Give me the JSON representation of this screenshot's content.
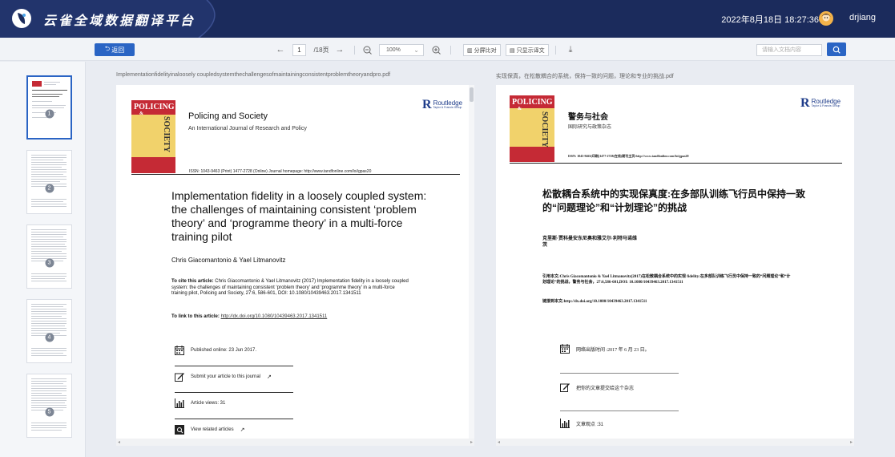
{
  "header": {
    "app_title": "云雀全域数据翻译平台",
    "datetime": "2022年8月18日 18:27:36",
    "username": "drjiang"
  },
  "toolbar": {
    "back_label": "返回",
    "current_page": "1",
    "total_pages": "/18页",
    "zoom": "100%",
    "split_compare": "分屏比对",
    "only_translation": "只显示译文",
    "search_placeholder": "请输入文档内容"
  },
  "thumbnails": [
    {
      "num": "1"
    },
    {
      "num": "2"
    },
    {
      "num": "3"
    },
    {
      "num": "4"
    },
    {
      "num": "5"
    }
  ],
  "left_doc": {
    "filename": "Implementationfidelityinaloosely coupledsystemthechallengesofmaintainingconsistentproblemtheoryandpro.pdf",
    "journal_cover_top": "POLICING",
    "journal_cover_amp": "&",
    "journal_cover_vertical": "SOCIETY",
    "journal_title": "Policing and Society",
    "journal_subtitle": "An International Journal of Research and Policy",
    "issn": "ISSN: 1043-9463 (Print) 1477-2728 (Online) Journal homepage: http://www.tandfonline.com/loi/gpas20",
    "publisher": "Routledge",
    "publisher_sub": "Taylor & Francis Group",
    "title": "Implementation fidelity in a loosely coupled system: the challenges of maintaining consistent ‘problem theory’ and ‘programme theory’ in a multi-force training pilot",
    "authors": "Chris Giacomantonio & Yael Litmanovitz",
    "cite_label": "To cite this article:",
    "cite_text": " Chris Giacomantonio & Yael Litmanovitz (2017) Implementation fidelity in a loosely coupled system: the challenges of maintaining consistent ‘problem theory’ and ‘programme theory’ in a multi-force training pilot, Policing and Society, 27:6, 586-601, DOI: 10.1080/10439463.2017.1341511",
    "link_label": "To link to this article: ",
    "link_url": "http://dx.doi.org/10.1080/10439463.2017.1341511",
    "published": "Published online: 23 Jun 2017.",
    "submit": "Submit your article to this journal",
    "views": "Article views: 31",
    "related": "View related articles"
  },
  "right_doc": {
    "filename": "实现保真，在松散耦合的系统，保持一致的问题，理论和专业的挑战.pdf",
    "journal_cover_top": "POLICING",
    "journal_cover_amp": "&",
    "journal_cover_vertical": "SOCIETY",
    "journal_title": "警务与社会",
    "journal_subtitle": "国际研究与政策杂志",
    "issn": "ISSN: 1043-9463(印刷)1477-2728(在线)期刊主页:http://www.tandfonline.com/loi/gpas20",
    "publisher": "Routledge",
    "publisher_sub": "Taylor & Francis Group",
    "title": "松散耦合系统中的实现保真度:在多部队训练飞行员中保持一致的“问题理论”和“计划理论”的挑战",
    "authors": "克里斯·贾科曼安东尼奥和雅艾尔·利特马诺维茨",
    "cite": "引用本文:Chris Giacomantonio & Yael Litmanovitz(2017)在松散耦合系统中的实现 fidelity:在多部队训练飞行员中保持一致的“问题理论”和“计划理论”的挑战，警务与社会，27:6,586-601,DOI: 10.1080/10439463.2017.1341511",
    "link": "链接到本文:http://dx.doi.org/10.1080/10439463.2017.1341511",
    "published": "网络出版时间 :2017 年 6 月 23 日。",
    "submit": "把你的文章提交给这个杂志",
    "views": "文章观点 :31"
  },
  "colors": {
    "header_bg": "#1b2b5c",
    "accent": "#2a64c4",
    "cover_red": "#c52a35",
    "cover_yellow": "#f1d26b"
  }
}
